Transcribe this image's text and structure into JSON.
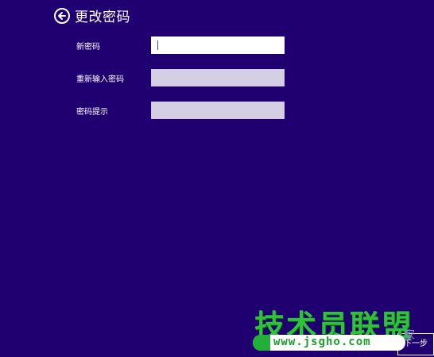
{
  "header": {
    "title": "更改密码",
    "back_icon": "back-arrow-circle-icon"
  },
  "form": {
    "new_password_label": "新密码",
    "new_password_value": "",
    "confirm_password_label": "重新输入密码",
    "confirm_password_value": "",
    "hint_label": "密码提示",
    "hint_value": ""
  },
  "buttons": {
    "next_label": "下一步"
  },
  "watermark": {
    "brand": "技术员联盟",
    "url": "www.jsgho.com",
    "home_char": "家"
  },
  "colors": {
    "background": "#200071",
    "active_field": "#ffffff",
    "inactive_field": "#d5cfe6",
    "watermark_green": "#2fc23a"
  }
}
